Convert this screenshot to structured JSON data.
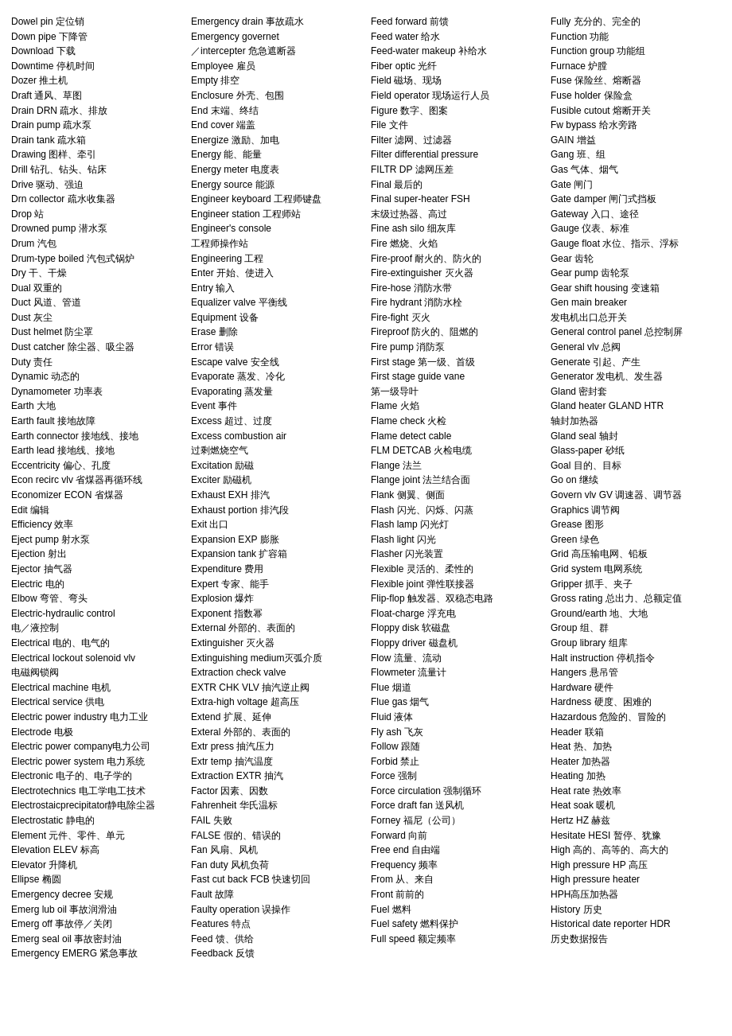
{
  "columns": [
    {
      "id": "col1",
      "entries": [
        "Dowel pin 定位销",
        "Down pipe 下降管",
        "Download 下载",
        "Downtime 停机时间",
        "Dozer 推土机",
        "Draft 通风、草图",
        "Drain DRN 疏水、排放",
        "Drain pump 疏水泵",
        "Drain tank 疏水箱",
        "Drawing 图样、牵引",
        "Drill 钻孔、钻头、钻床",
        "Drive 驱动、强迫",
        "Drn collector 疏水收集器",
        "Drop 站",
        "Drowned pump 潜水泵",
        "Drum 汽包",
        "Drum-type boiled 汽包式锅炉",
        "Dry 干、干燥",
        "Dual 双重的",
        "Duct 风道、管道",
        "Dust 灰尘",
        "Dust helmet 防尘罩",
        "Dust catcher 除尘器、吸尘器",
        "Duty 责任",
        "Dynamic 动态的",
        "Dynamometer 功率表",
        "Earth 大地",
        "Earth fault 接地故障",
        "Earth connector 接地线、接地",
        "Earth lead 接地线、接地",
        "Eccentricity 偏心、孔度",
        "Econ recirc vlv 省煤器再循环线",
        "Economizer ECON 省煤器",
        "Edit 编辑",
        "Efficiency 效率",
        "Eject pump 射水泵",
        "Ejection 射出",
        "Ejector 抽气器",
        "Electric 电的",
        "Elbow 弯管、弯头",
        "Electric-hydraulic control",
        "  电／液控制",
        "Electrical 电的、电气的",
        "Electrical lockout solenoid vlv",
        "  电磁阀锁阀",
        "Electrical machine 电机",
        "Electrical service 供电",
        "Electric power industry 电力工业",
        "Electrode 电极",
        "Electric power company电力公司",
        "Electric power system 电力系统",
        "Electronic 电子的、电子学的",
        "Electrotechnics 电工学电工技术",
        "Electrostaicprecipitator静电除尘器",
        "Electrostatic 静电的",
        "Element 元件、零件、单元",
        "Elevation ELEV 标高",
        "Elevator 升降机",
        "Ellipse 椭圆",
        "Emergency decree 安规",
        "Emerg lub oil 事故润滑油",
        "Emerg off 事故停／关闭",
        "Emerg seal oil 事故密封油",
        "Emergency EMERG 紧急事故"
      ]
    },
    {
      "id": "col2",
      "entries": [
        "Emergency drain 事故疏水",
        "Emergency governet",
        "  ／intercepter 危急遮断器",
        "Employee 雇员",
        "Empty 排空",
        "Enclosure 外壳、包围",
        "End 末端、终结",
        "End cover 端盖",
        "Energize 激励、加电",
        "Energy 能、能量",
        "Energy meter 电度表",
        "Energy source 能源",
        "Engineer keyboard 工程师键盘",
        "Engineer station 工程师站",
        "Engineer's console",
        "  工程师操作站",
        "Engineering 工程",
        "Enter 开始、使进入",
        "Entry 输入",
        "Equalizer valve 平衡线",
        "Equipment 设备",
        "Erase 删除",
        "Error 错误",
        "Escape valve 安全线",
        "Evaporate 蒸发、冷化",
        "Evaporating 蒸发量",
        "Event 事件",
        "Excess 超过、过度",
        "Excess combustion air",
        "  过剩燃烧空气",
        "Excitation 励磁",
        "Exciter 励磁机",
        "Exhaust EXH 排汽",
        "Exhaust portion 排汽段",
        "Exit 出口",
        "Expansion EXP 膨胀",
        "Expansion tank 扩容箱",
        "Expenditure 费用",
        "Expert 专家、能手",
        "Explosion 爆炸",
        "Exponent 指数幂",
        "External 外部的、表面的",
        "Extinguisher 灭火器",
        "Extinguishing medium灭弧介质",
        "Extraction check valve",
        "EXTR CHK VLV 抽汽逆止阀",
        "Extra-high voltage 超高压",
        "Extend 扩展、延伸",
        "Exteral 外部的、表面的",
        "Extr press 抽汽压力",
        "Extr temp 抽汽温度",
        "Extraction EXTR 抽汽",
        "Factor 因素、因数",
        "Fahrenheit 华氏温标",
        "FAIL 失败",
        "FALSE 假的、错误的",
        "Fan 风扇、风机",
        "Fan duty 风机负荷",
        "Fast cut back FCB 快速切回",
        "Fault 故障",
        "Faulty operation 误操作",
        "Features 特点",
        "Feed 馈、供给",
        "Feedback 反馈"
      ]
    },
    {
      "id": "col3",
      "entries": [
        "Feed forward 前馈",
        "Feed water 给水",
        "Feed-water makeup 补给水",
        "Fiber optic 光纤",
        "Field 磁场、现场",
        "Field operator 现场运行人员",
        "Figure 数字、图案",
        "File 文件",
        "Filter 滤网、过滤器",
        "Filter differential pressure",
        "  FILTR DP 滤网压差",
        "Final 最后的",
        "Final super-heater FSH",
        "  末级过热器、高过",
        "Fine ash silo 细灰库",
        "Fire 燃烧、火焰",
        "Fire-proof 耐火的、防火的",
        "Fire-extinguisher 灭火器",
        "Fire-hose 消防水带",
        "Fire hydrant 消防水栓",
        "Fire-fight 灭火",
        "Fireproof 防火的、阻燃的",
        "Fire pump 消防泵",
        "First stage 第一级、首级",
        "First stage guide vane",
        "  第一级导叶",
        "Flame 火焰",
        "Flame check 火检",
        "Flame detect cable",
        "  FLM DETCAB 火检电缆",
        "Flange 法兰",
        "Flange joint 法兰结合面",
        "Flank 侧翼、侧面",
        "Flash 闪光、闪烁、闪蒸",
        "Flash lamp 闪光灯",
        "Flash light 闪光",
        "Flasher 闪光装置",
        "Flexible 灵活的、柔性的",
        "Flexible joint 弹性联接器",
        "Flip-flop 触发器、双稳态电路",
        "Float-charge 浮充电",
        "Floppy disk 软磁盘",
        "Floppy driver 磁盘机",
        "Flow 流量、流动",
        "Flowmeter 流量计",
        "Flue 烟道",
        "Flue gas 烟气",
        "Fluid 液体",
        "Fly ash 飞灰",
        "Follow 跟随",
        "Forbid 禁止",
        "Force 强制",
        "Force circulation 强制循环",
        "Force draft fan 送风机",
        "Forney 福尼（公司）",
        "Forward 向前",
        "Free end 自由端",
        "Frequency 频率",
        "From 从、来自",
        "Front 前前的",
        "Fuel 燃料",
        "Fuel safety 燃料保护",
        "Full speed 额定频率"
      ]
    },
    {
      "id": "col4",
      "entries": [
        "Fully 充分的、完全的",
        "Function 功能",
        "Function group 功能组",
        "Furnace 炉膛",
        "Fuse 保险丝、熔断器",
        "Fuse holder 保险盒",
        "Fusible cutout 熔断开关",
        "Fw bypass 给水旁路",
        "GAIN 增益",
        "Gang 班、组",
        "Gas 气体、烟气",
        "Gate 闸门",
        "Gate damper 闸门式挡板",
        "Gateway 入口、途径",
        "Gauge 仪表、标准",
        "Gauge float 水位、指示、浮标",
        "Gear 齿轮",
        "Gear pump 齿轮泵",
        "Gear shift housing 变速箱",
        "Gen main breaker",
        "  发电机出口总开关",
        "General control panel 总控制屏",
        "General vlv 总阀",
        "Generate 引起、产生",
        "Generator 发电机、发生器",
        "Gland 密封套",
        "Gland heater GLAND HTR",
        "  轴封加热器",
        "Gland seal 轴封",
        "Glass-paper 砂纸",
        "Goal 目的、目标",
        "Go on 继续",
        "Govern vlv GV 调速器、调节器",
        "Graphics 调节阀",
        "Grease 图形",
        "Green 绿色",
        "Grid 高压输电网、铅板",
        "Grid system 电网系统",
        "Gripper 抓手、夹子",
        "Gross rating 总出力、总额定值",
        "Ground/earth 地、大地",
        "Group 组、群",
        "Group library 组库",
        "Halt instruction 停机指令",
        "Hangers 悬吊管",
        "Hardware 硬件",
        "Hardness 硬度、困难的",
        "Hazardous 危险的、冒险的",
        "Header 联箱",
        "Heat 热、加热",
        "Heater 加热器",
        "Heating 加热",
        "Heat rate 热效率",
        "Heat soak 暖机",
        "Hertz HZ 赫兹",
        "Hesitate HESI 暂停、犹豫",
        "High 高的、高等的、高大的",
        "High pressure HP 高压",
        "High pressure heater",
        "  HPH高压加热器",
        "History 历史",
        "Historical date reporter HDR",
        "  历史数据报告"
      ]
    }
  ]
}
